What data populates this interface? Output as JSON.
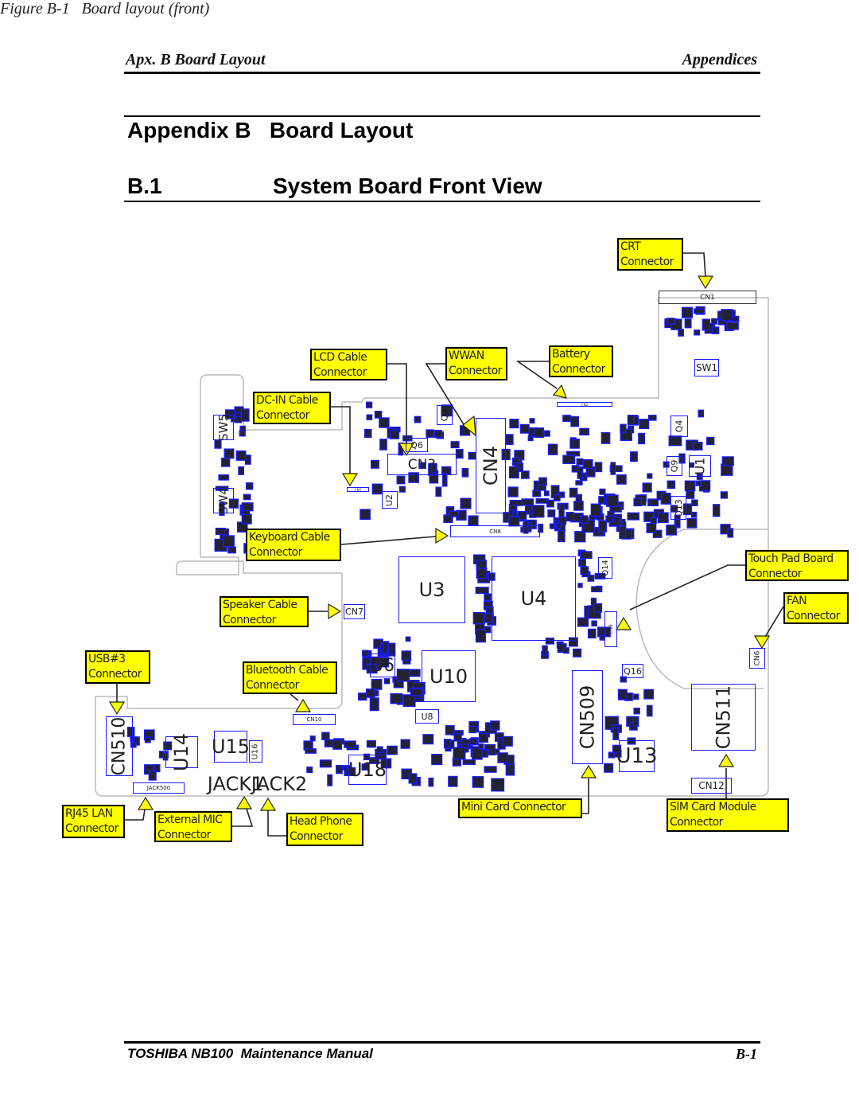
{
  "header": {
    "left": "Apx. B  Board Layout",
    "right": "Appendices"
  },
  "title": {
    "appendix": "Appendix B   Board Layout",
    "section_number": "B.1",
    "section_title": "System Board Front View"
  },
  "figure": {
    "caption": "Figure B-1   Board layout (front)",
    "colors": {
      "callout_fill": "#ffff00",
      "component_outline": "#1a1aff",
      "board_outline": "#bbbbbb"
    },
    "callouts": [
      {
        "id": "crt",
        "line1": "CRT",
        "line2": "Connector"
      },
      {
        "id": "lcd",
        "line1": "LCD Cable",
        "line2": "Connector"
      },
      {
        "id": "wwan",
        "line1": "WWAN",
        "line2": "Connector"
      },
      {
        "id": "battery",
        "line1": "Battery",
        "line2": "Connector"
      },
      {
        "id": "dcin",
        "line1": "DC-IN Cable",
        "line2": "Connector"
      },
      {
        "id": "keyboard",
        "line1": "Keyboard Cable",
        "line2": "Connector"
      },
      {
        "id": "touchpad",
        "line1": "Touch Pad Board",
        "line2": "Connector"
      },
      {
        "id": "fan",
        "line1": "FAN",
        "line2": "Connector"
      },
      {
        "id": "speaker",
        "line1": "Speaker Cable",
        "line2": "Connector"
      },
      {
        "id": "usb3",
        "line1": "USB#3",
        "line2": "Connector"
      },
      {
        "id": "bluetooth",
        "line1": "Bluetooth Cable",
        "line2": "Connector"
      },
      {
        "id": "rj45",
        "line1": "RJ45 LAN",
        "line2": "Connector"
      },
      {
        "id": "extmic",
        "line1": "External MIC",
        "line2": "Connector"
      },
      {
        "id": "headphone",
        "line1": "Head Phone",
        "line2": "Connector"
      },
      {
        "id": "minicard",
        "line1": "Mini Card Connector",
        "line2": ""
      },
      {
        "id": "simcard",
        "line1": "SIM Card Module",
        "line2": "Connector"
      }
    ],
    "components": [
      "CN1",
      "SW1",
      "CN3",
      "Q6",
      "Q3",
      "CN4",
      "U2",
      "CN8",
      "U3",
      "U4",
      "CN7",
      "U6",
      "U10",
      "U8",
      "CN10",
      "CN509",
      "Q16",
      "CN511",
      "CN12",
      "U13",
      "CN510",
      "U14",
      "U15",
      "U16",
      "U18",
      "JACK500",
      "JACK1",
      "JACK2",
      "SW5",
      "SW4",
      "Q4",
      "Q9",
      "U1",
      "Q13",
      "Q14",
      "CN9",
      "CN6",
      "CN2",
      "CN5"
    ]
  },
  "footer": {
    "left": "TOSHIBA NB100  Maintenance Manual",
    "right": "B-1"
  }
}
